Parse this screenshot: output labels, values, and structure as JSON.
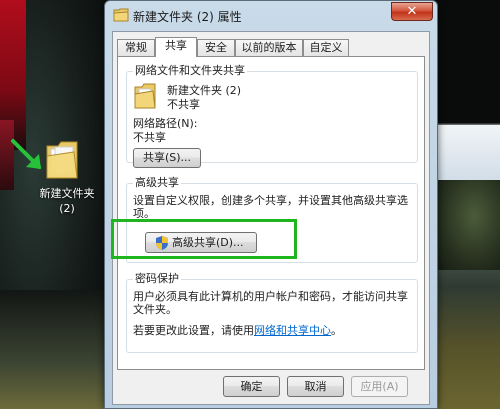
{
  "desktop": {
    "folder_label_line1": "新建文件夹",
    "folder_label_line2": "(2)",
    "arrow_color": "#27c23a"
  },
  "window": {
    "title": "新建文件夹 (2) 属性",
    "close_label": "✕"
  },
  "tabs": [
    {
      "label": "常规",
      "active": false
    },
    {
      "label": "共享",
      "active": true
    },
    {
      "label": "安全",
      "active": false
    },
    {
      "label": "以前的版本",
      "active": false
    },
    {
      "label": "自定义",
      "active": false
    }
  ],
  "network_sharing": {
    "group_title": "网络文件和文件夹共享",
    "folder_name": "新建文件夹 (2)",
    "folder_status": "不共享",
    "path_label": "网络路径(N):",
    "path_value": "不共享",
    "share_button": "共享(S)..."
  },
  "advanced_sharing": {
    "group_title": "高级共享",
    "description": "设置自定义权限，创建多个共享，并设置其他高级共享选项。",
    "description_line1": "设置自定义权限，创建多个共享，并设置其他高级共享选",
    "description_line2": "项。",
    "button": "高级共享(D)...",
    "highlight_color": "#1fb51f"
  },
  "password_protection": {
    "group_title": "密码保护",
    "line1": "用户必须具有此计算机的用户帐户和密码，才能访问共享",
    "line2": "文件夹。",
    "change_prefix": "若要更改此设置，请使用",
    "change_link": "网络和共享中心",
    "change_suffix": "。"
  },
  "footer": {
    "ok": "确定",
    "cancel": "取消",
    "apply": "应用(A)"
  }
}
